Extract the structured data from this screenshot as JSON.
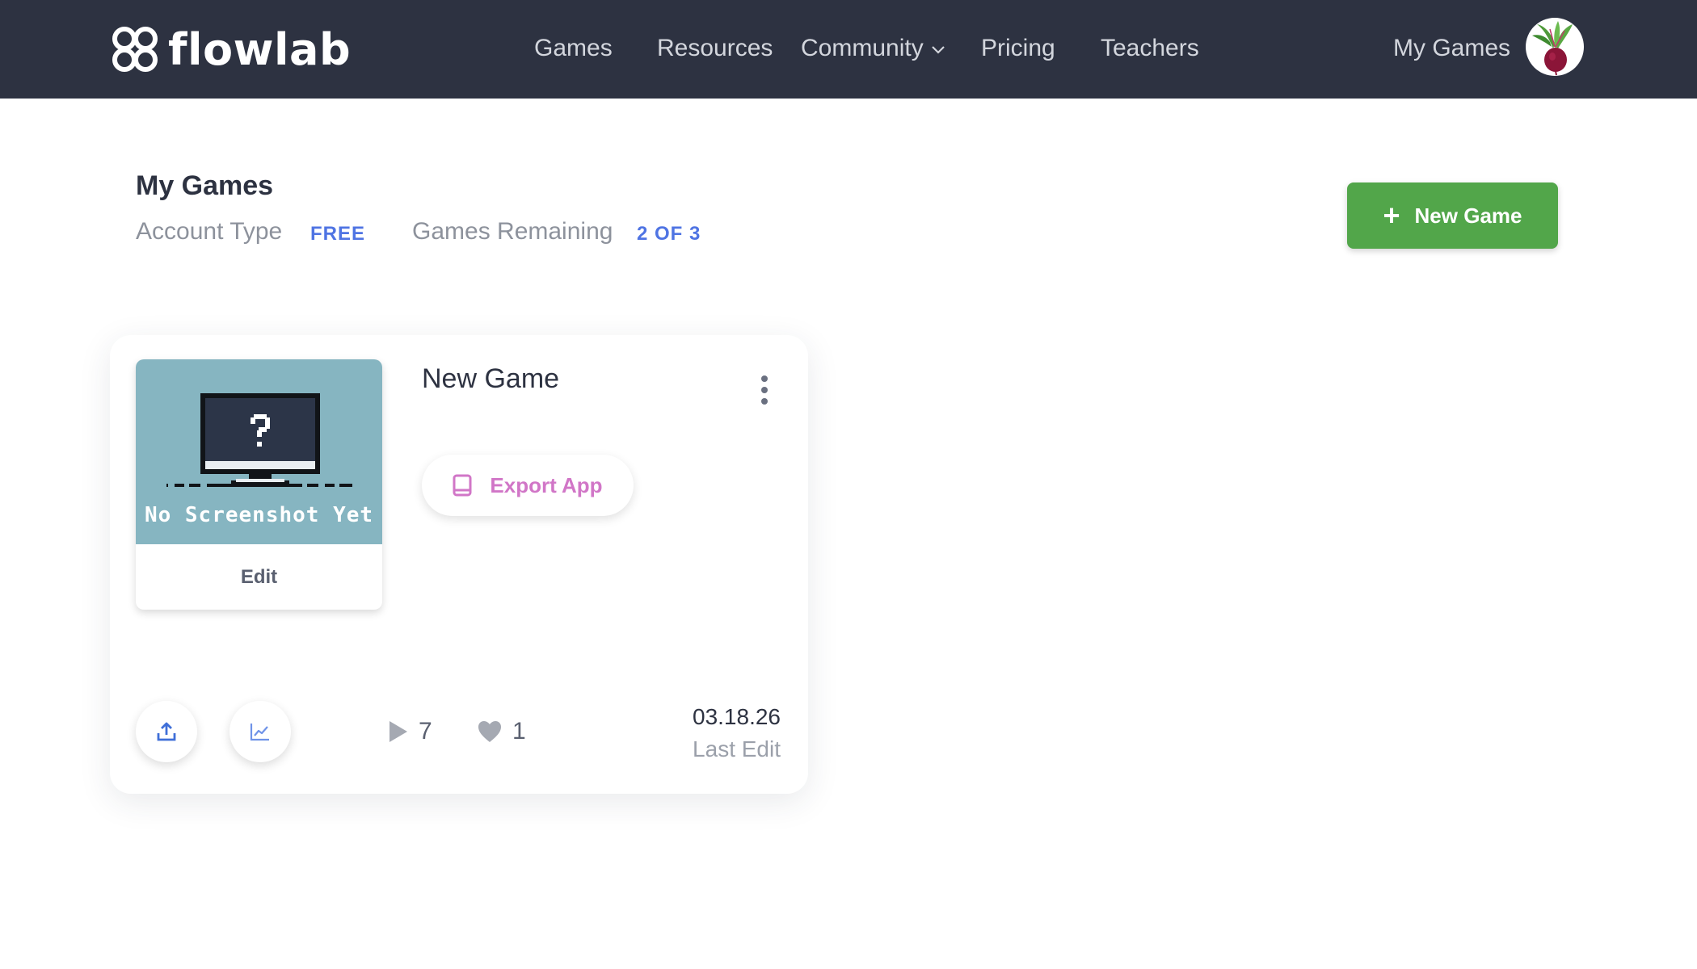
{
  "brand": {
    "name": "flowlab"
  },
  "nav": {
    "games": "Games",
    "resources": "Resources",
    "community": "Community",
    "pricing": "Pricing",
    "teachers": "Teachers",
    "my_games": "My Games"
  },
  "header": {
    "title": "My Games",
    "account_type_label": "Account Type",
    "account_type_value": "FREE",
    "games_remaining_label": "Games Remaining",
    "games_remaining_value": "2 OF 3",
    "new_game_button": "New Game"
  },
  "game_card": {
    "thumbnail_caption": "No Screenshot Yet",
    "edit_label": "Edit",
    "title": "New Game",
    "export_label": "Export App",
    "plays": "7",
    "likes": "1",
    "date": "03.18.26",
    "last_edit_label": "Last Edit"
  },
  "colors": {
    "navbar": "#2d3241",
    "accent_blue": "#4f74e3",
    "new_game_green": "#52a64a",
    "export_pink": "#d176c7",
    "thumbnail_bg": "#86b5c1"
  },
  "icons": {
    "logo": "flowlab-knot-icon",
    "community_dropdown": "chevron-down-icon",
    "avatar": "beet-avatar",
    "new_game": "plus-icon",
    "thumbnail": "monitor-question-icon",
    "menu": "kebab-menu-icon",
    "export": "tablet-icon",
    "share": "upload-icon",
    "stats": "line-chart-icon",
    "plays": "play-icon",
    "likes": "heart-icon"
  }
}
